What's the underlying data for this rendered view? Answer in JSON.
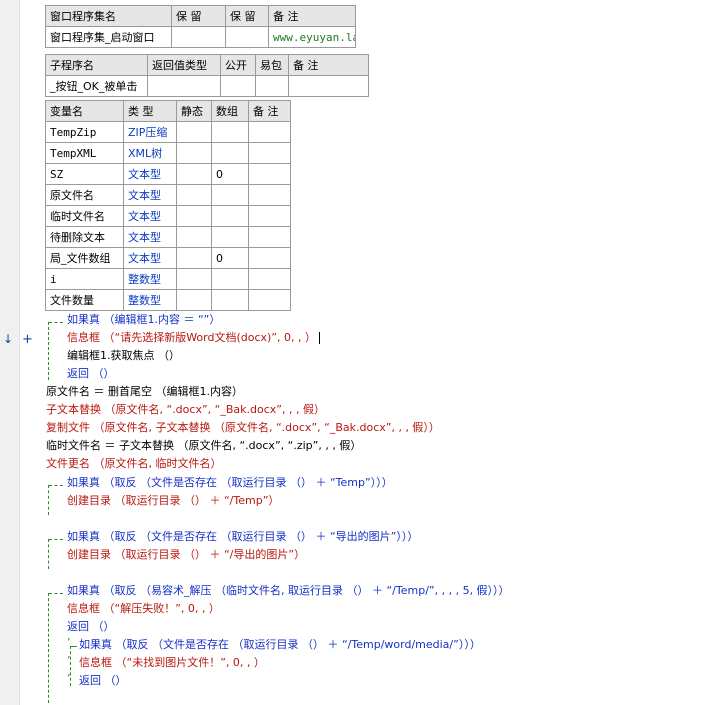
{
  "t1": {
    "headers": [
      "窗口程序集名",
      "保 留",
      "保 留",
      "备 注"
    ],
    "row": [
      "窗口程序集_启动窗口",
      "",
      "",
      "www.eyuyan.la"
    ]
  },
  "t2": {
    "headers": [
      "子程序名",
      "返回值类型",
      "公开",
      "易包",
      "备 注"
    ],
    "row": [
      "_按钮_OK_被单击",
      "",
      "",
      "",
      ""
    ]
  },
  "t3": {
    "headers": [
      "变量名",
      "类 型",
      "静态",
      "数组",
      "备 注"
    ],
    "rows": [
      [
        "TempZip",
        "ZIP压缩",
        "",
        "",
        ""
      ],
      [
        "TempXML",
        "XML树",
        "",
        "",
        ""
      ],
      [
        "SZ",
        "文本型",
        "",
        "0",
        ""
      ],
      [
        "原文件名",
        "文本型",
        "",
        "",
        ""
      ],
      [
        "临时文件名",
        "文本型",
        "",
        "",
        ""
      ],
      [
        "待删除文本",
        "文本型",
        "",
        "",
        ""
      ],
      [
        "局_文件数组",
        "文本型",
        "",
        "0",
        ""
      ],
      [
        "i",
        "整数型",
        "",
        "",
        ""
      ],
      [
        "文件数量",
        "整数型",
        "",
        "",
        ""
      ]
    ]
  },
  "gutter": {
    "arrow": "↓",
    "plus": "+"
  },
  "code": [
    "如果真 （编辑框1.内容 ＝ “”）",
    "信息框 （“请先选择新版Word文档(docx)”, 0, , ）",
    "编辑框1.获取焦点 （）",
    "返回 （）",
    "原文件名 ＝ 删首尾空 （编辑框1.内容）",
    "子文本替换 （原文件名, “.docx”, “_Bak.docx”, , , 假）",
    "复制文件 （原文件名, 子文本替换 （原文件名, “.docx”, “_Bak.docx”, , , 假））",
    "临时文件名 ＝ 子文本替换 （原文件名, “.docx”, “.zip”, , , 假）",
    "文件更名 （原文件名, 临时文件名）",
    "如果真 （取反 （文件是否存在 （取运行目录 （） ＋ “Temp”）））",
    "创建目录 （取运行目录 （） ＋ “/Temp”）",
    "如果真 （取反 （文件是否存在 （取运行目录 （） ＋ “导出的图片”）））",
    "创建目录 （取运行目录 （） ＋ “/导出的图片”）",
    "如果真 （取反 （易容术_解压 （临时文件名, 取运行目录 （） ＋ “/Temp/”, , , , 5, 假）））",
    "信息框 （“解压失败！”, 0, , ）",
    "返回 （）",
    "如果真 （取反 （文件是否存在 （取运行目录 （） ＋ “/Temp/word/media/”）））",
    "信息框 （“未找到图片文件！”, 0, , ）",
    "返回 （）"
  ]
}
